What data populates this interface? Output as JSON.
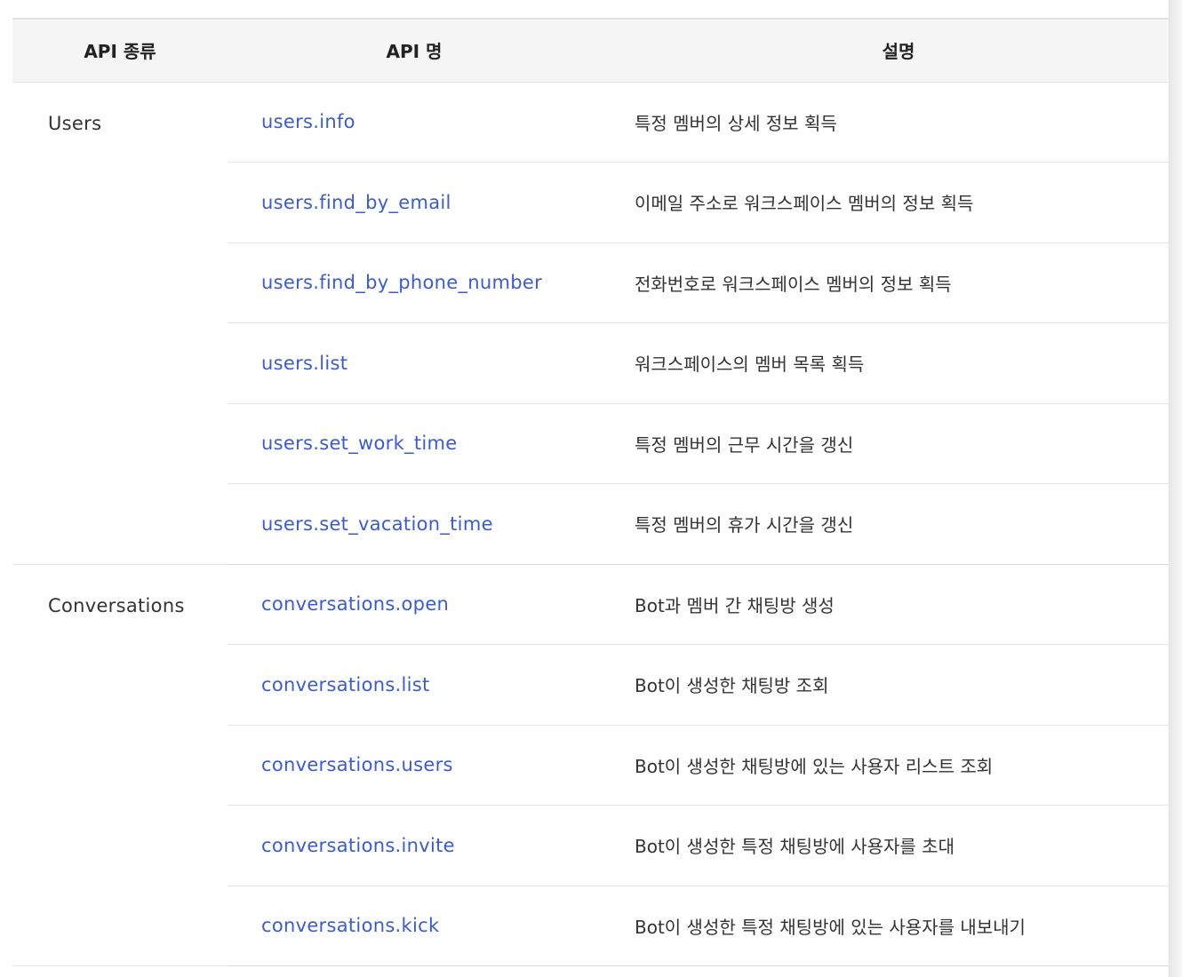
{
  "headers": {
    "type": "API 종류",
    "name": "API 명",
    "description": "설명"
  },
  "groups": [
    {
      "name": "Users",
      "rows": [
        {
          "api": "users.info",
          "description": "특정 멤버의 상세 정보 획득"
        },
        {
          "api": "users.find_by_email",
          "description": "이메일 주소로 워크스페이스 멤버의 정보 획득"
        },
        {
          "api": "users.find_by_phone_number",
          "description": "전화번호로 워크스페이스 멤버의 정보 획득"
        },
        {
          "api": "users.list",
          "description": "워크스페이스의 멤버 목록 획득"
        },
        {
          "api": "users.set_work_time",
          "description": "특정 멤버의 근무 시간을 갱신"
        },
        {
          "api": "users.set_vacation_time",
          "description": "특정 멤버의 휴가 시간을 갱신"
        }
      ]
    },
    {
      "name": "Conversations",
      "rows": [
        {
          "api": "conversations.open",
          "description": "Bot과 멤버 간 채팅방 생성"
        },
        {
          "api": "conversations.list",
          "description": "Bot이 생성한 채팅방 조회"
        },
        {
          "api": "conversations.users",
          "description": "Bot이 생성한 채팅방에 있는 사용자 리스트 조회"
        },
        {
          "api": "conversations.invite",
          "description": "Bot이 생성한 특정 채팅방에 사용자를 초대"
        },
        {
          "api": "conversations.kick",
          "description": "Bot이 생성한 특정 채팅방에 있는 사용자를 내보내기"
        }
      ]
    }
  ],
  "colors": {
    "link": "#3a5bd5",
    "header_bg": "#f5f5f5",
    "text": "#333333"
  }
}
